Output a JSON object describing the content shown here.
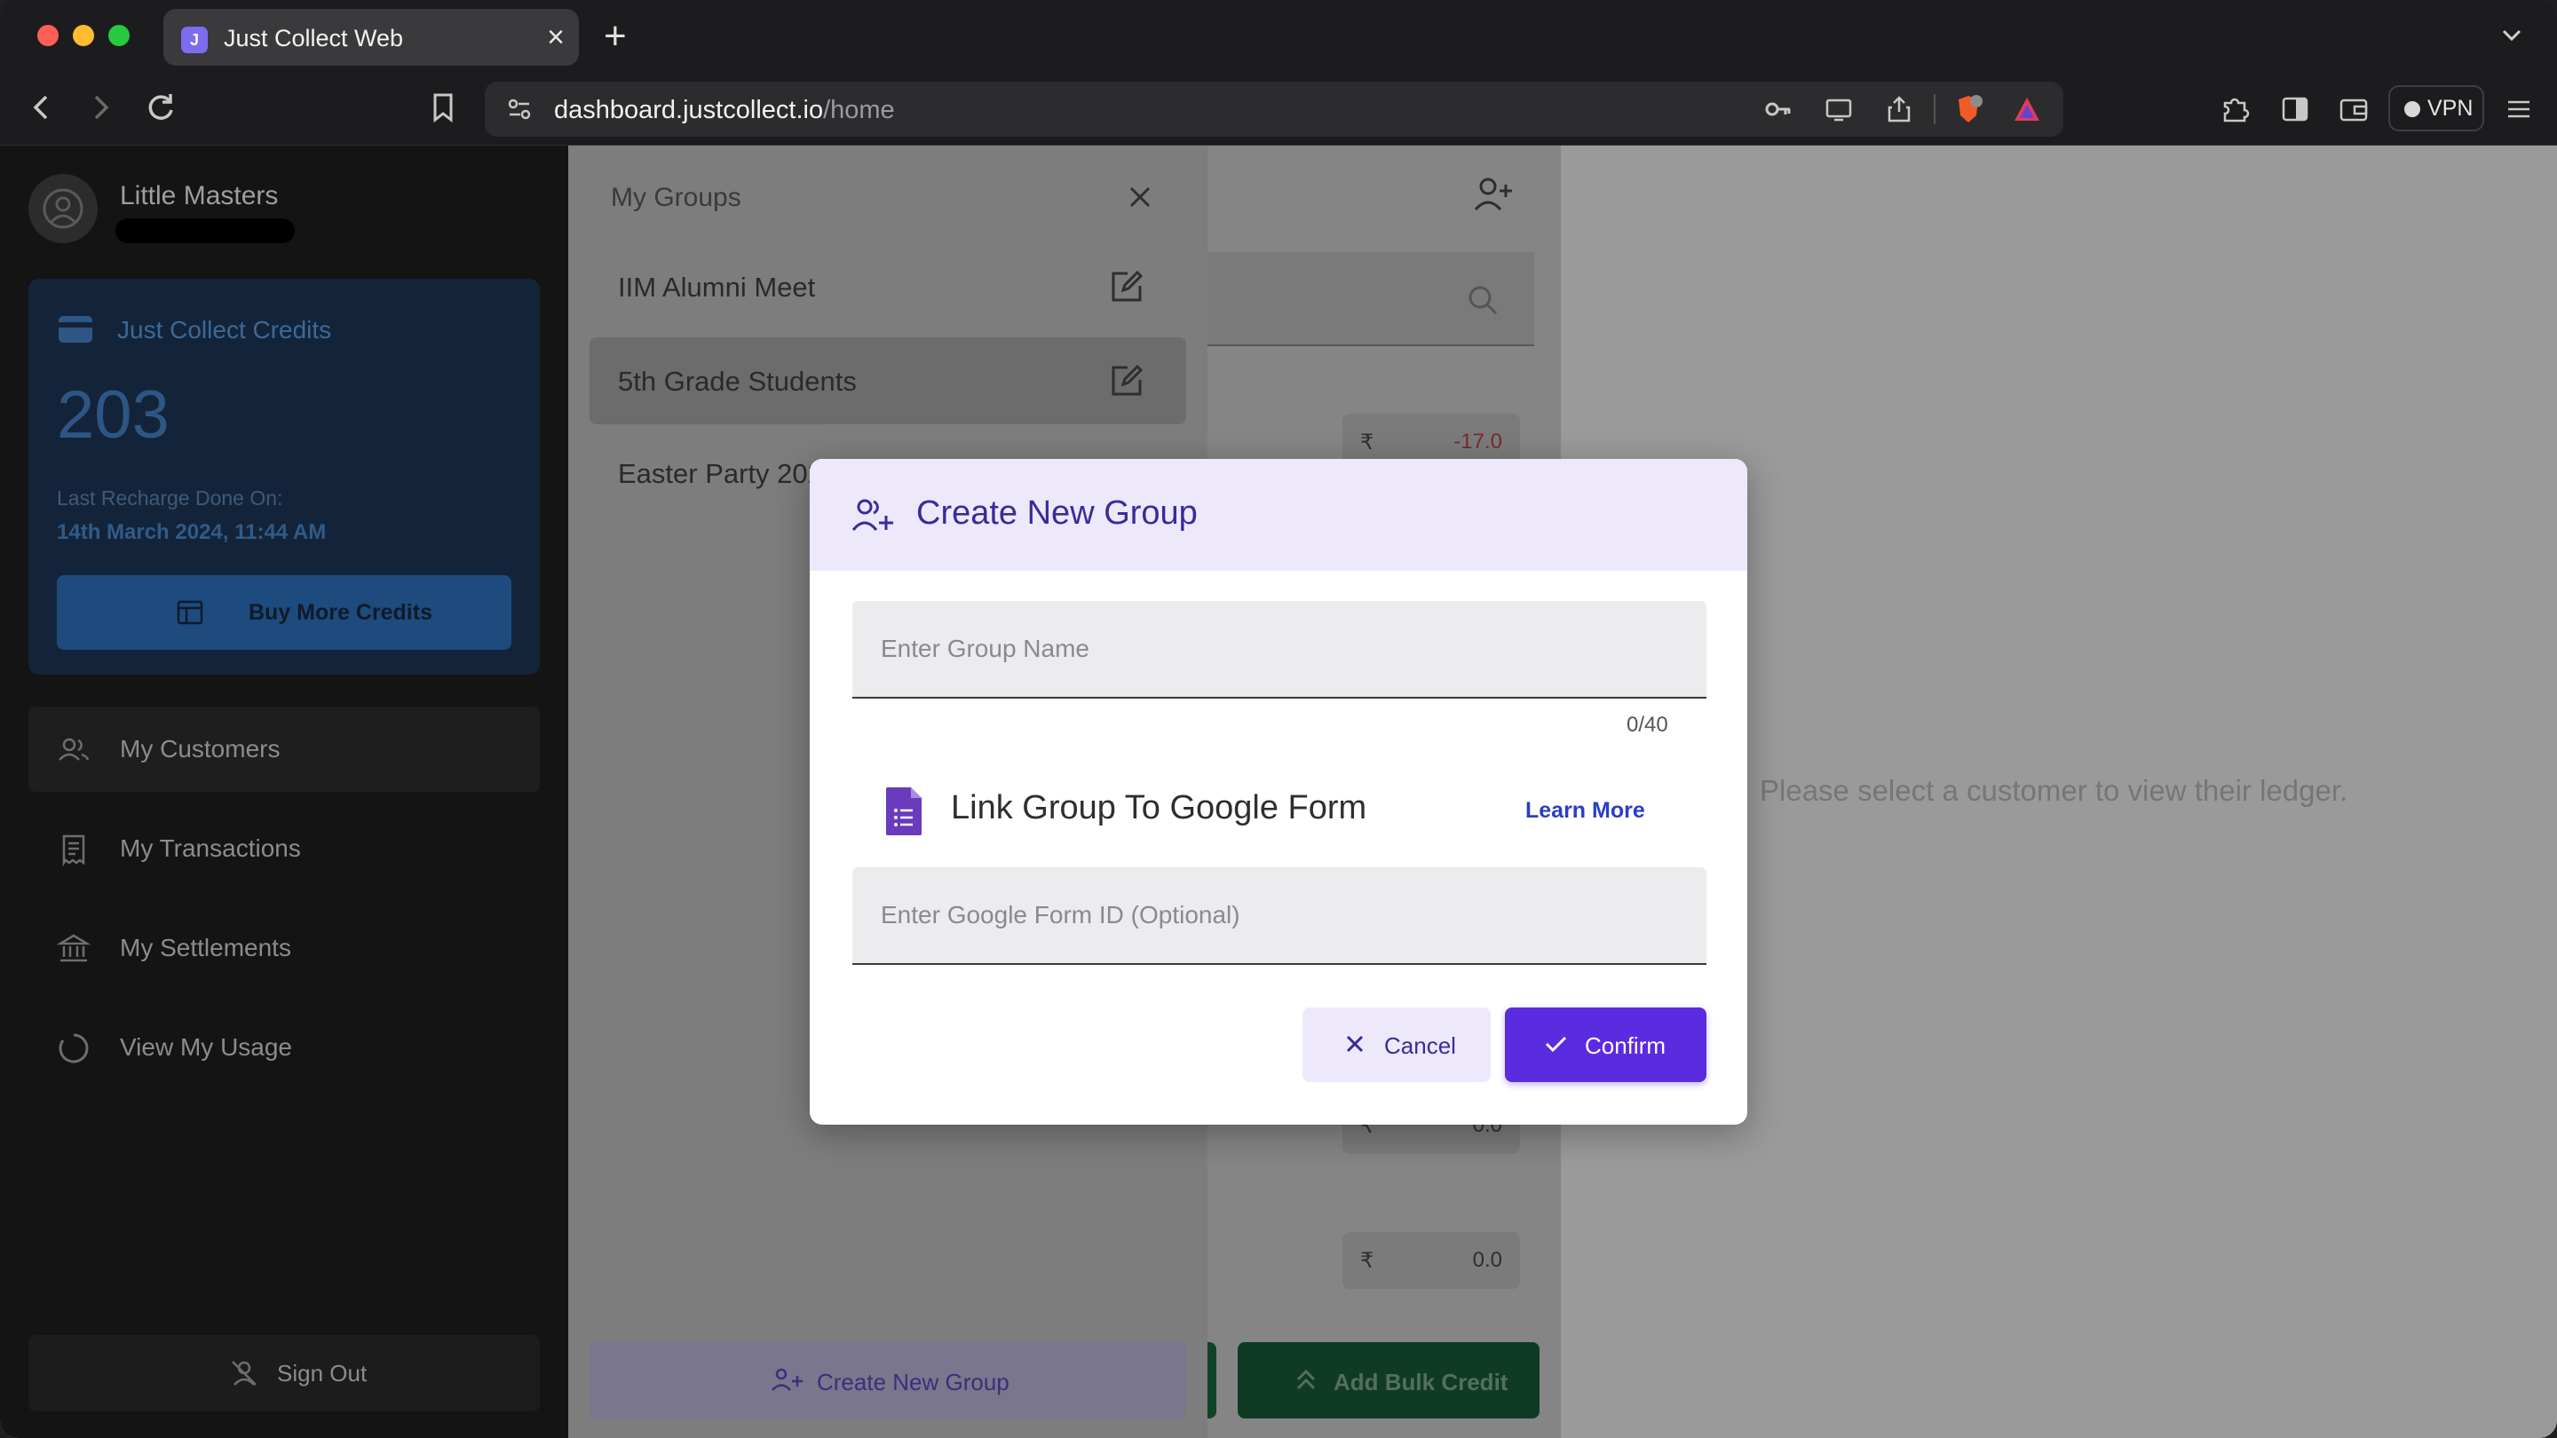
{
  "browser": {
    "tab_title": "Just Collect Web",
    "tab_favicon_letter": "J",
    "url_domain": "dashboard.justcollect.io",
    "url_path": "/home",
    "vpn_label": "VPN",
    "shield_badge": "3"
  },
  "sidebar": {
    "org_name": "Little Masters",
    "credits": {
      "label": "Just Collect Credits",
      "value": "203",
      "recharge_label": "Last Recharge Done On:",
      "recharge_date": "14th March 2024, 11:44 AM",
      "buy_button": "Buy More Credits"
    },
    "items": [
      {
        "label": "My Customers",
        "icon": "customers-icon",
        "active": true
      },
      {
        "label": "My Transactions",
        "icon": "transactions-icon",
        "active": false
      },
      {
        "label": "My Settlements",
        "icon": "bank-icon",
        "active": false
      },
      {
        "label": "View My Usage",
        "icon": "usage-icon",
        "active": false
      }
    ],
    "sign_out": "Sign Out"
  },
  "groups_panel": {
    "title": "My Groups",
    "groups": [
      {
        "label": "IIM Alumni Meet",
        "active": false
      },
      {
        "label": "5th Grade Students",
        "active": true
      },
      {
        "label": "Easter Party 2024",
        "active": false
      }
    ],
    "create_button": "Create New Group"
  },
  "customers_panel": {
    "currency": "₹",
    "amounts": [
      "-17.0",
      "0.0",
      "0.0"
    ],
    "bulk_button": "Add Bulk Credit"
  },
  "ledger": {
    "empty_message": "Please select a customer to view their ledger."
  },
  "modal": {
    "title": "Create New Group",
    "group_name_placeholder": "Enter Group Name",
    "group_name_value": "",
    "counter": "0/40",
    "link_label": "Link Group To Google Form",
    "learn_more": "Learn More",
    "form_id_placeholder": "Enter Google Form ID (Optional)",
    "form_id_value": "",
    "cancel": "Cancel",
    "confirm": "Confirm"
  },
  "colors": {
    "accent": "#5b2be0",
    "modal_header": "#ede9fa",
    "credits_blue": "#1d4b7d"
  }
}
